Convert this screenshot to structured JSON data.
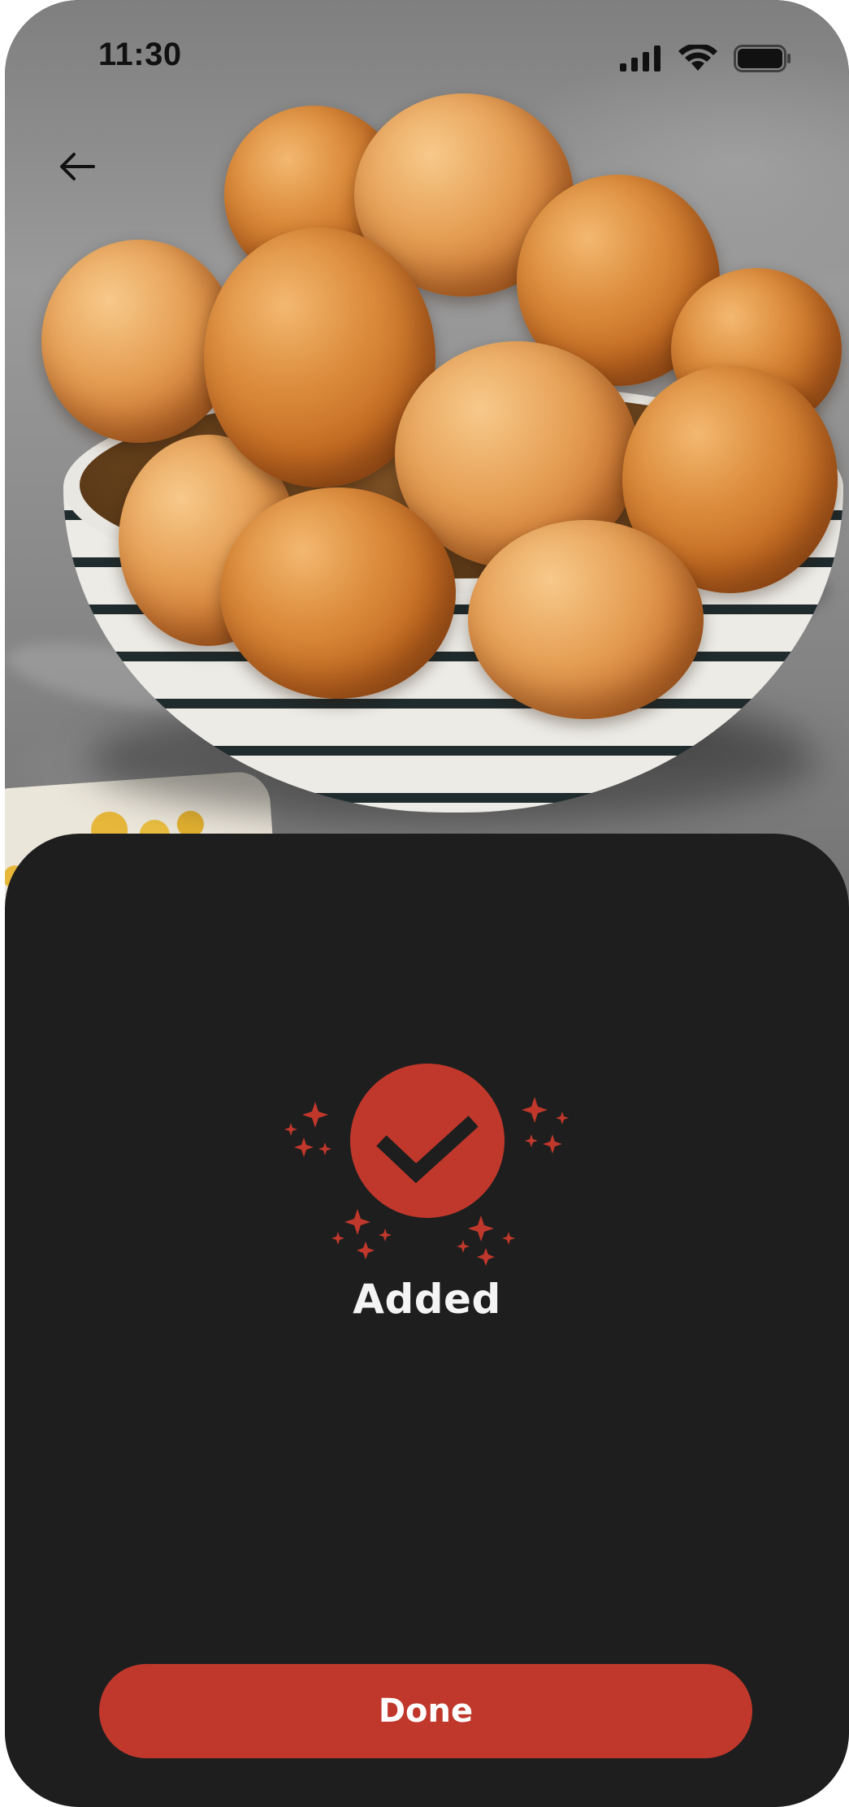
{
  "status_bar": {
    "time": "11:30",
    "icons": [
      "cellular-signal-icon",
      "wifi-icon",
      "battery-icon"
    ]
  },
  "navigation": {
    "back_icon": "arrow-left-icon"
  },
  "hero": {
    "image_subject": "bowl-of-fried-puff-puff-icon"
  },
  "confirmation": {
    "icon": "check-circle-icon",
    "sparkle_icon": "sparkle-icon",
    "label": "Added"
  },
  "actions": {
    "done_label": "Done"
  },
  "colors": {
    "accent": "#c0382b",
    "sheet_background": "#1e1e1f",
    "text_light": "#f4f4f4",
    "check_mark": "#1e1e1f"
  }
}
